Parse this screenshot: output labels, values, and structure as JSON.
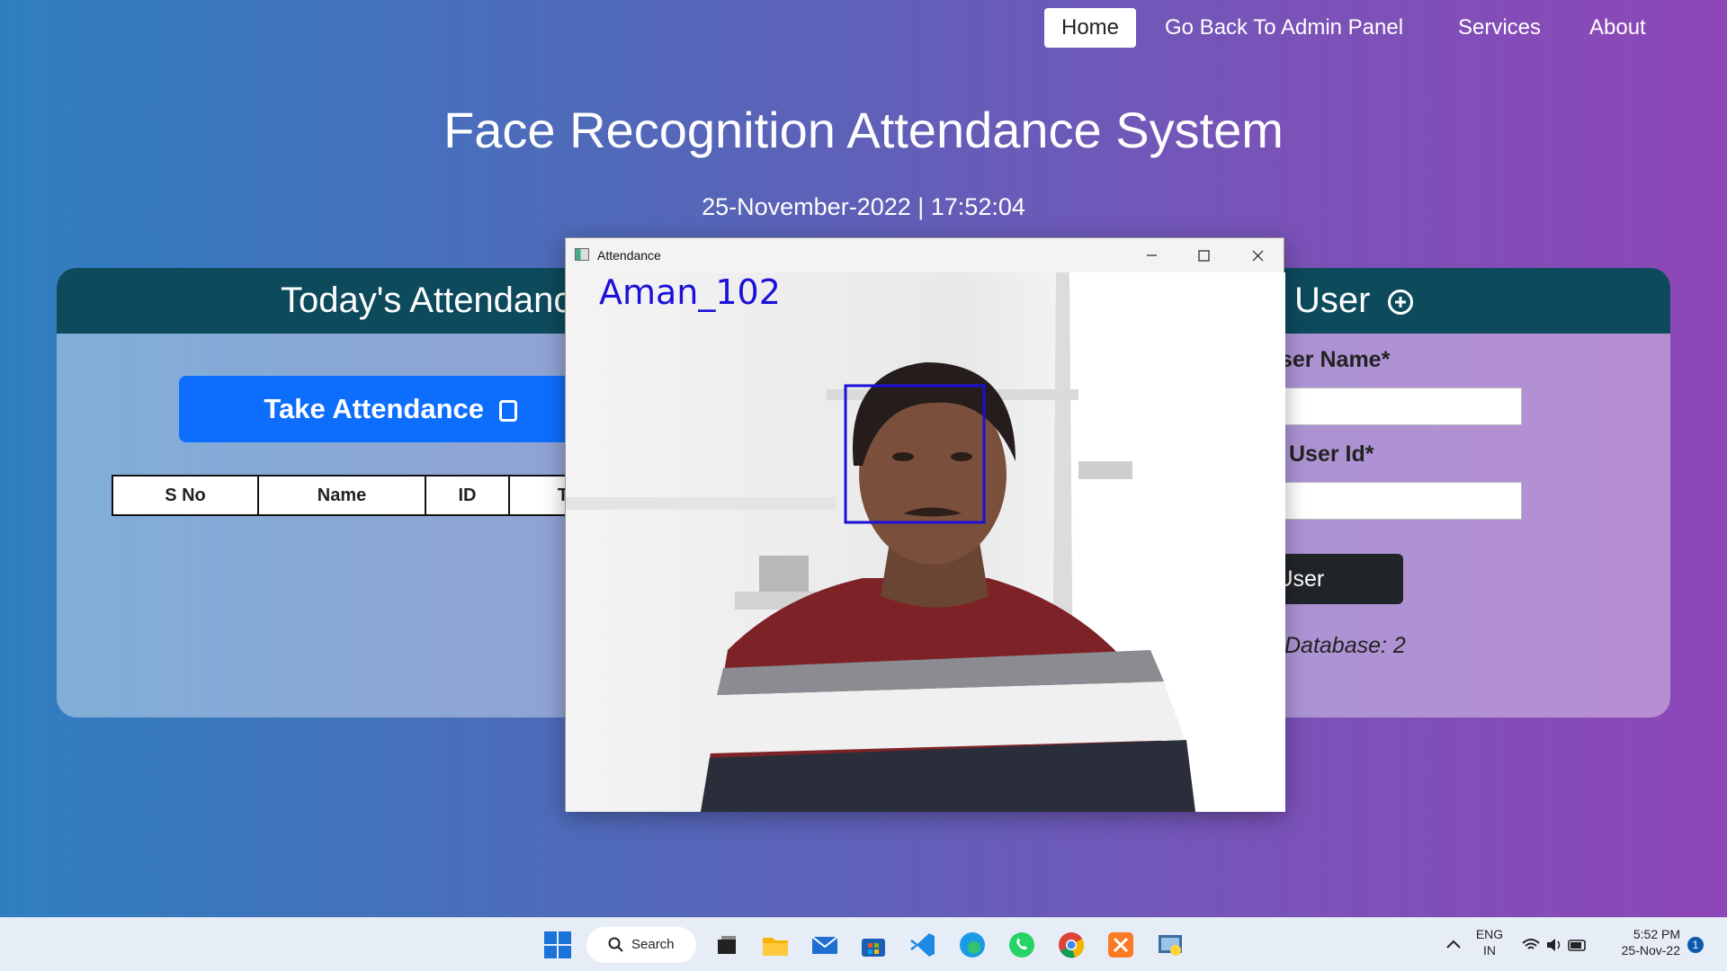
{
  "nav": {
    "home": "Home",
    "admin": "Go Back To Admin Panel",
    "services": "Services",
    "about": "About"
  },
  "page": {
    "title": "Face Recognition Attendance System",
    "datetime": "25-November-2022 | 17:52:04"
  },
  "attendance_panel": {
    "header": "Today's Attendanc",
    "take_button": "Take Attendance",
    "columns": [
      "S No",
      "Name",
      "ID",
      "T"
    ]
  },
  "user_panel": {
    "header": "User",
    "name_label": "ser Name*",
    "id_label": "User Id*",
    "add_button": "v User",
    "db_text": "Database: 2"
  },
  "camera_window": {
    "title": "Attendance",
    "detected_label": "Aman_102"
  },
  "taskbar": {
    "search": "Search",
    "lang_top": "ENG",
    "lang_bottom": "IN",
    "time": "5:52 PM",
    "date": "25-Nov-22",
    "notification_count": "1"
  },
  "colors": {
    "header_teal": "#0d4a5c",
    "primary_blue": "#0d6efd",
    "dark_button": "#212529",
    "face_box": "#1a10d8"
  }
}
